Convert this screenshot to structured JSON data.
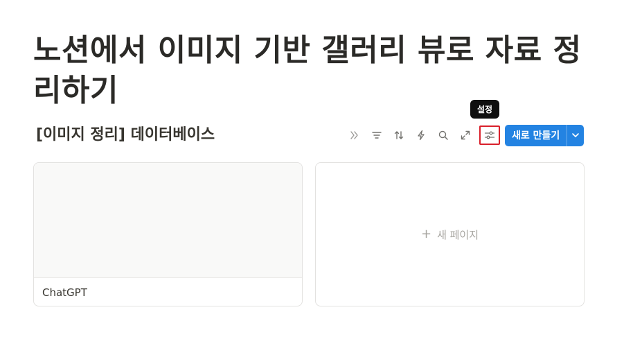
{
  "page": {
    "title": "노션에서 이미지 기반 갤러리 뷰로 자료 정리하기"
  },
  "database": {
    "title": "[이미지 정리] 데이터베이스",
    "toolbar": {
      "icons": [
        "double-chevron-right-icon",
        "filter-icon",
        "sort-icon",
        "lightning-icon",
        "search-icon",
        "expand-icon",
        "settings-sliders-icon"
      ],
      "new_button_label": "새로 만들기"
    },
    "tooltip": "설정",
    "cards": [
      {
        "title": "ChatGPT"
      }
    ],
    "new_page_label": "새 페이지"
  },
  "colors": {
    "accent": "#2383e2",
    "highlight": "#d9202b",
    "tooltip_bg": "#0f0f0f"
  }
}
